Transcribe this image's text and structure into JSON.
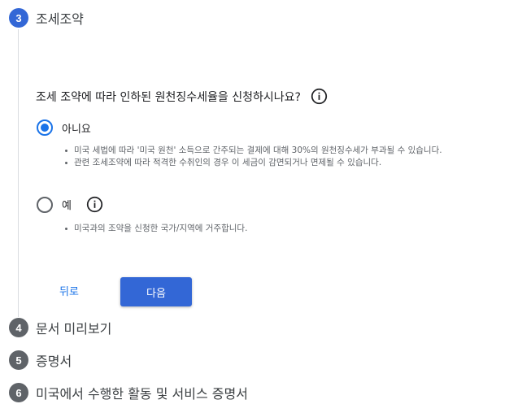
{
  "steps": {
    "current": {
      "number": "3",
      "title": "조세조약"
    },
    "upcoming": [
      {
        "number": "4",
        "title": "문서 미리보기"
      },
      {
        "number": "5",
        "title": "증명서"
      },
      {
        "number": "6",
        "title": "미국에서 수행한 활동 및 서비스 증명서"
      }
    ]
  },
  "question": {
    "text": "조세 조약에 따라 인하된 원천징수세율을 신청하시나요?",
    "icon": "info-icon"
  },
  "options": [
    {
      "label": "아니요",
      "selected": true,
      "bullets": [
        "미국 세법에 따라 '미국 원천' 소득으로 간주되는 결제에 대해 30%의 원천징수세가 부과될 수 있습니다.",
        "관련 조세조약에 따라 적격한 수취인의 경우 이 세금이 감면되거나 면제될 수 있습니다."
      ]
    },
    {
      "label": "예",
      "selected": false,
      "icon": "info-icon",
      "bullets": [
        "미국과의 조약을 신청한 국가/지역에 거주합니다."
      ]
    }
  ],
  "actions": {
    "back_label": "뒤로",
    "next_label": "다음"
  },
  "colors": {
    "accent": "#3367d6",
    "radio_selected": "#1a73e8",
    "step_inactive": "#5f6368"
  }
}
